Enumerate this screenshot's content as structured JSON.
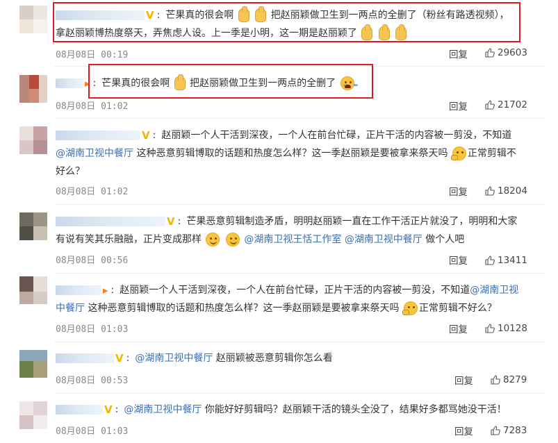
{
  "comments": [
    {
      "text_a": "芒果真的很会啊",
      "text_b": "把赵丽颖做卫生到一两点的全删了（粉丝有路透视频），",
      "text_c": "拿赵丽颖博热度祭天，弄焦虑人设。上一季是小明，这一期是赵丽颖了",
      "time": "08月08日 00:19",
      "reply": "回复",
      "likes": "29603"
    },
    {
      "text_a": "芒果真的很会啊",
      "text_b": "把赵丽颖做卫生到一两点的全删了",
      "time": "08月08日 01:02",
      "reply": "回复",
      "likes": "21702"
    },
    {
      "text_a": "赵丽颖一个人干活到深夜，一个人在前台忙碌，正片干活的内容被一剪没，不知道",
      "mention": "@湖南卫视中餐厅",
      "text_b": "这种恶意剪辑博取的话题和热度怎么样？这一季赵丽颖是要被拿来祭天吗",
      "text_c": "正常剪辑不",
      "text_d": "好么？",
      "time": "08月08日 01:02",
      "reply": "回复",
      "likes": "18204"
    },
    {
      "text_a": "芒果恶意剪辑制造矛盾，明明赵丽颖一直在工作干活正片就没了，明明和大家",
      "text_b": "有说有笑其乐融融，正片变成那样",
      "mention_a": "@湖南卫视王恬工作室",
      "mention_b": "@湖南卫视中餐厅",
      "text_c": "做个人吧",
      "time": "08月08日 00:56",
      "reply": "回复",
      "likes": "13411"
    },
    {
      "text_a": "赵丽颖一个人干活到深夜，一个人在前台忙碌，正片干活的内容被一剪没，不知道",
      "mention_a": "@湖南卫视",
      "mention_b": "中餐厅",
      "text_b": "这种恶意剪辑博取的话题和热度怎么样？这一季赵丽颖是要被拿来祭天吗",
      "text_c": "正常剪辑不好么？",
      "time": "08月08日 01:03",
      "reply": "回复",
      "likes": "10128"
    },
    {
      "mention": "@湖南卫视中餐厅",
      "text_a": "赵丽颖被恶意剪辑你怎么看",
      "time": "08月08日 00:53",
      "reply": "回复",
      "likes": "8279"
    },
    {
      "mention": "@湖南卫视中餐厅",
      "text_a": "你能好好剪辑吗？赵丽颖干活的镜头全没了，结果好多都骂她没干活！",
      "time": "08月08日 01:03",
      "reply": "回复",
      "likes": "7283"
    }
  ],
  "colors": {
    "highlight": "#e0191e",
    "mention": "#3a6fb5",
    "vip": "#f6b400"
  },
  "icons": {
    "like": "thumbs-up-outline-icon",
    "thumb_emoji": "thumbs-up-emoji",
    "vip_badge": "v-badge-icon"
  }
}
